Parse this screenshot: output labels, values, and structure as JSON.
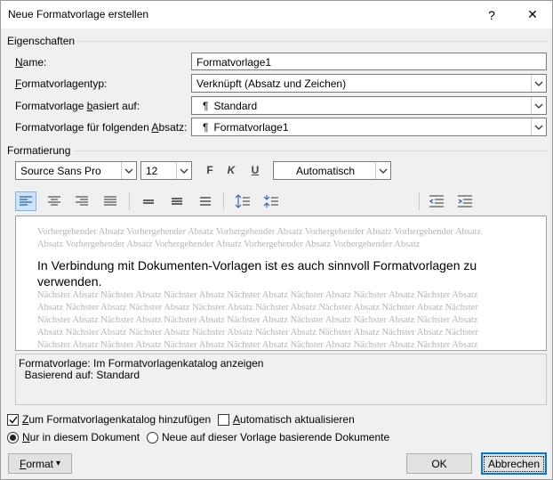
{
  "window": {
    "title": "Neue Formatvorlage erstellen",
    "help_label": "?",
    "close_label": "✕"
  },
  "properties": {
    "section_label": "Eigenschaften",
    "name_label_pre": "",
    "name_label_u": "N",
    "name_label_post": "ame:",
    "name_value": "Formatvorlage1",
    "type_label_pre": "",
    "type_label_u": "F",
    "type_label_post": "ormatvorlagentyp:",
    "type_value": "Verknüpft (Absatz und Zeichen)",
    "based_label_pre": "Formatvorlage ",
    "based_label_u": "b",
    "based_label_post": "asiert auf:",
    "based_value": "Standard",
    "next_label_pre": "Formatvorlage für folgenden ",
    "next_label_u": "A",
    "next_label_post": "bsatz:",
    "next_value": "Formatvorlage1",
    "paragraph_mark": "¶"
  },
  "formatting": {
    "section_label": "Formatierung",
    "font": "Source Sans Pro",
    "size": "12",
    "bold_label": "F",
    "italic_label": "K",
    "underline_label": "U",
    "color": "Automatisch"
  },
  "preview": {
    "previous_lines": [
      "Vorhergehender Absatz Vorhergehender Absatz Vorhergehender Absatz Vorhergehender Absatz Vorhergehender Absatz",
      "Absatz Vorhergehender Absatz Vorhergehender Absatz Vorhergehender Absatz Vorhergehender Absatz"
    ],
    "sample_text": "In Verbindung mit Dokumenten-Vorlagen ist es auch sinnvoll Formatvorlagen zu verwenden.",
    "next_lines": [
      "Nächster Absatz Nächster Absatz Nächster Absatz Nächster Absatz Nächster Absatz Nächster Absatz Nächster Absatz",
      "Absatz Nächster Absatz Nächster Absatz Nächster Absatz Nächster Absatz Nächster Absatz Nächster Absatz Nächster",
      "Nächster Absatz Nächster Absatz Nächster Absatz Nächster Absatz Nächster Absatz Nächster Absatz Nächster Absatz",
      "Absatz Nächster Absatz Nächster Absatz Nächster Absatz Nächster Absatz Nächster Absatz Nächster Absatz Nächster",
      "Nächster Absatz Nächster Absatz Nächster Absatz Nächster Absatz Nächster Absatz Nächster Absatz Nächster Absatz"
    ]
  },
  "description": {
    "line1": "Formatvorlage: Im Formatvorlagenkatalog anzeigen",
    "line2": "  Basierend auf: Standard"
  },
  "options": {
    "add_to_gallery_u": "Z",
    "add_to_gallery_rest": "um Formatvorlagenkatalog hinzufügen",
    "add_to_gallery_checked": true,
    "auto_update_u": "A",
    "auto_update_rest": "utomatisch aktualisieren",
    "auto_update_checked": false,
    "only_doc_u": "N",
    "only_doc_rest": "ur in diesem Dokument",
    "only_doc_selected": true,
    "new_docs_label": "Neue auf dieser Vorlage basierende Dokumente"
  },
  "buttons": {
    "format_u": "F",
    "format_rest": "ormat",
    "format_arrow": "▾",
    "ok": "OK",
    "cancel": "Abbrechen"
  },
  "colors": {
    "accent": "#0078d7",
    "active_tool_bg": "#cce4f7",
    "preview_ghost": "#b5b5b5"
  }
}
